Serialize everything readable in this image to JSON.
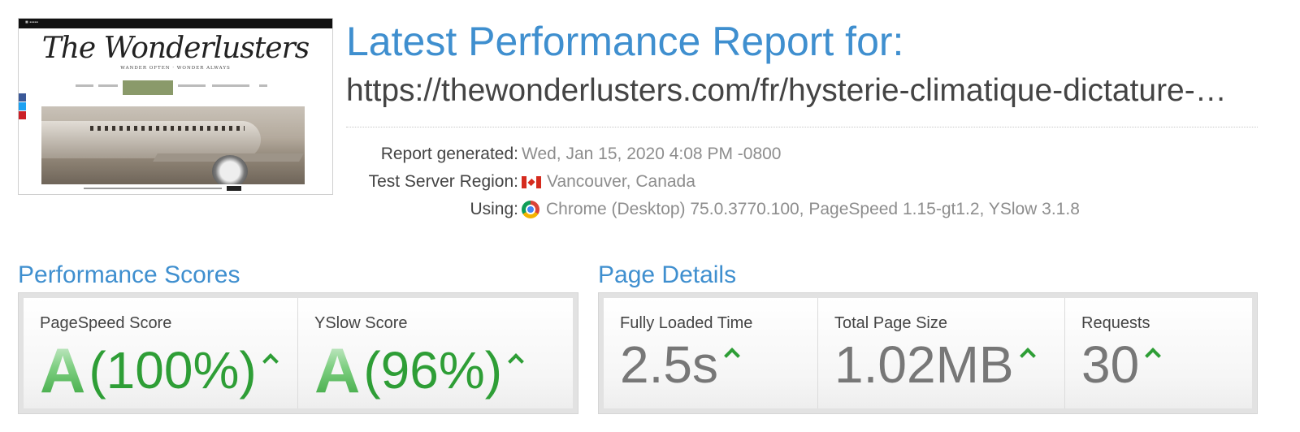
{
  "thumbnail": {
    "logo_text": "The Wonderlusters",
    "tagline": "WANDER OFTEN · WONDER ALWAYS"
  },
  "header": {
    "title": "Latest Performance Report for:",
    "url": "https://thewonderlusters.com/fr/hysterie-climatique-dictature-…"
  },
  "meta": {
    "report_generated_label": "Report generated:",
    "report_generated_value": "Wed, Jan 15, 2020 4:08 PM -0800",
    "region_label": "Test Server Region:",
    "region_value": "Vancouver, Canada",
    "using_label": "Using:",
    "using_value": "Chrome (Desktop) 75.0.3770.100, PageSpeed 1.15-gt1.2, YSlow 3.1.8"
  },
  "performance": {
    "title": "Performance Scores",
    "pagespeed_label": "PageSpeed Score",
    "pagespeed_grade": "A",
    "pagespeed_pct": "(100%)",
    "yslow_label": "YSlow Score",
    "yslow_grade": "A",
    "yslow_pct": "(96%)"
  },
  "details": {
    "title": "Page Details",
    "loaded_label": "Fully Loaded Time",
    "loaded_value": "2.5s",
    "size_label": "Total Page Size",
    "size_value": "1.02MB",
    "requests_label": "Requests",
    "requests_value": "30"
  },
  "colors": {
    "accent_blue": "#3f8fcf",
    "grade_green": "#2e9e36",
    "metric_gray": "#777777"
  },
  "icons": [
    "canada-flag-icon",
    "chrome-icon",
    "trend-up-icon"
  ]
}
